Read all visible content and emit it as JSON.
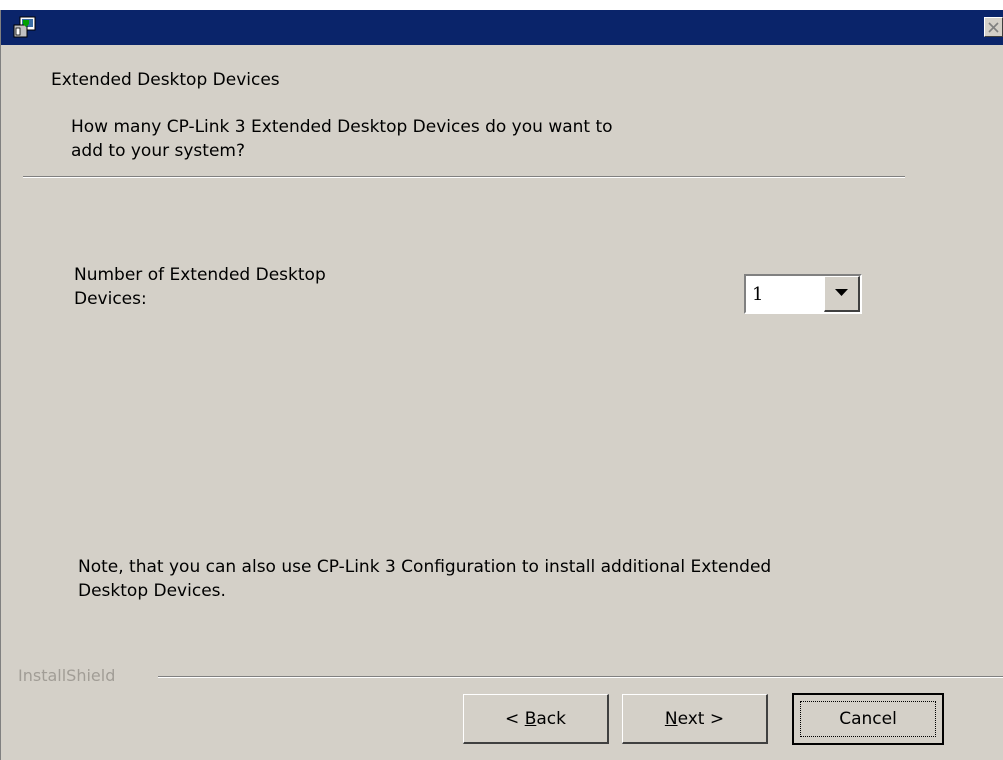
{
  "window": {
    "app_icon": "installer-icon",
    "close_icon": "close-icon"
  },
  "header": {
    "title": "Extended Desktop Devices",
    "description": "How many CP-Link 3 Extended Desktop Devices do you want to add to your system?"
  },
  "form": {
    "devices_label": "Number of Extended Desktop Devices:",
    "devices_value": "1"
  },
  "note": "Note, that you can also use CP-Link 3 Configuration to install additional Extended Desktop Devices.",
  "footer": {
    "brand": "InstallShield"
  },
  "buttons": {
    "back_prefix": "< ",
    "back_mnemonic": "B",
    "back_rest": "ack",
    "next_mnemonic": "N",
    "next_rest": "ext >",
    "cancel": "Cancel"
  },
  "colors": {
    "titlebar": "#0a246a",
    "dialog": "#d4d0c8"
  }
}
